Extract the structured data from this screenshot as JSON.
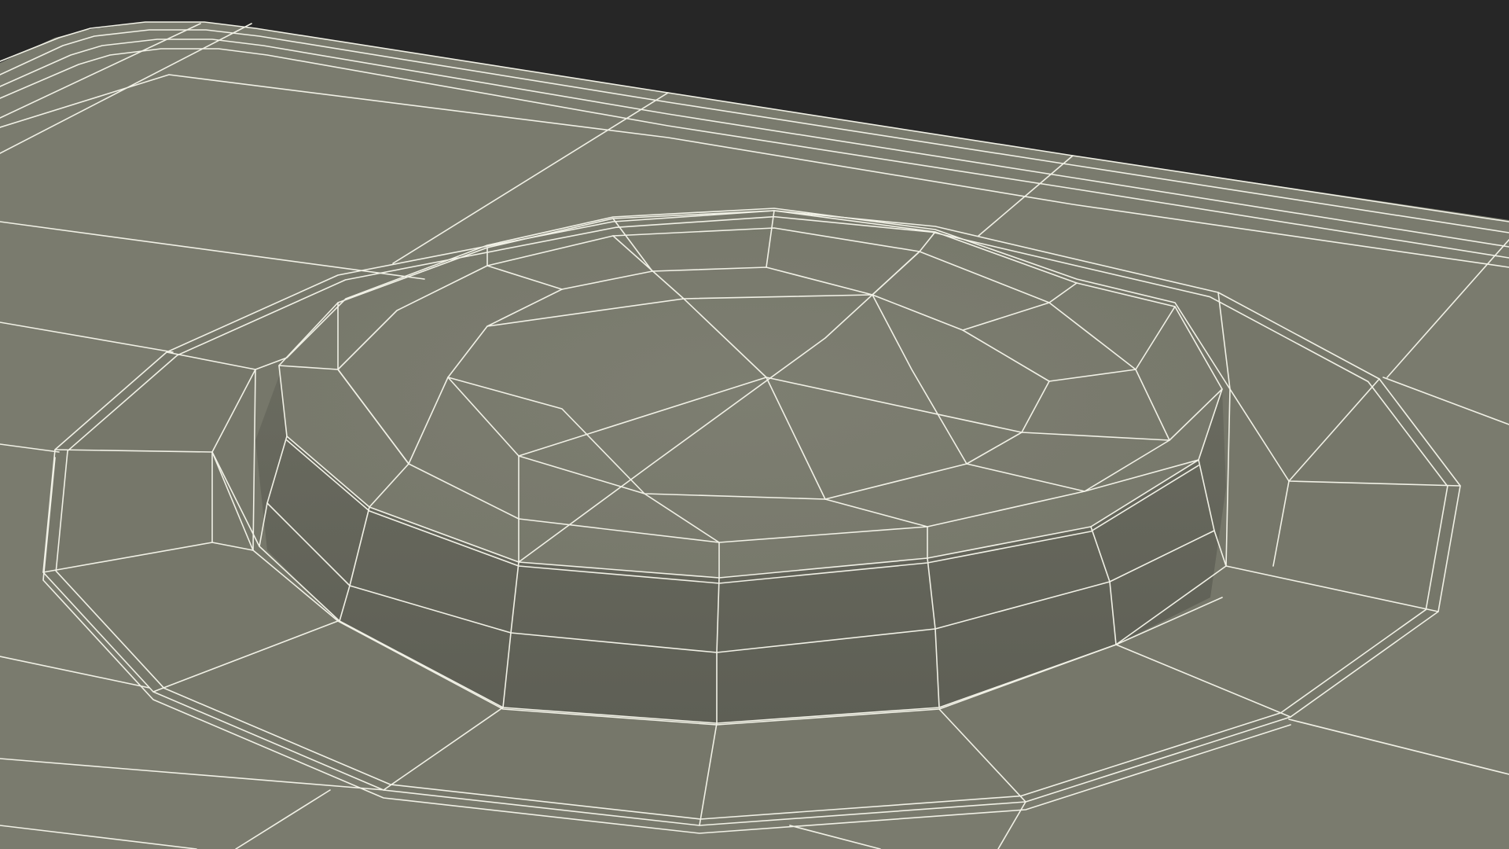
{
  "viewport": {
    "subject": "wireframe-mesh-render",
    "colors": {
      "background": "#262626",
      "surface": "#7a7b6e",
      "surface_dark": "#66675c",
      "surface_light": "#838478",
      "wire": "#f1f1e6"
    }
  }
}
